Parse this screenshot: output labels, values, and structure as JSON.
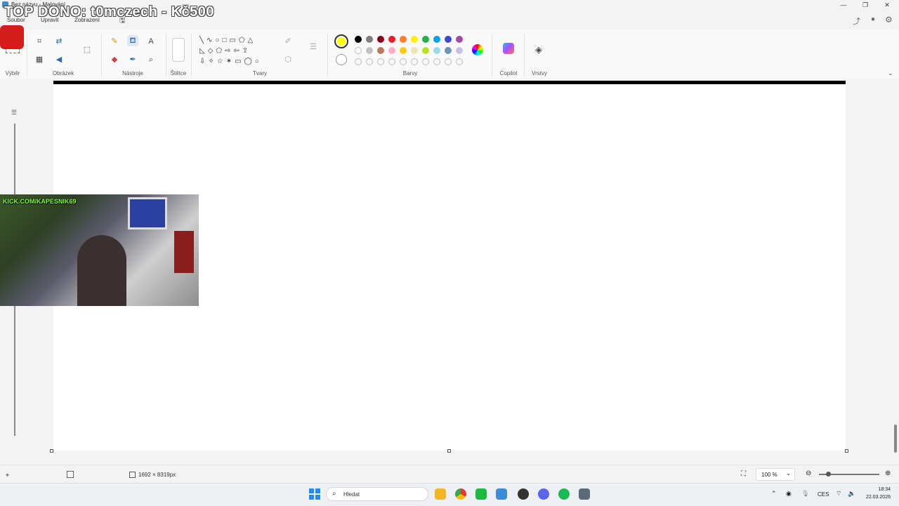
{
  "app": {
    "title": "Bez názvu - Malování"
  },
  "menu": [
    "Soubor",
    "Upravit",
    "Zobrazení"
  ],
  "ribbon": {
    "groups": [
      "Výběr",
      "Obrázek",
      "Nástroje",
      "Štětce",
      "Tvary",
      "Barvy",
      "Copilot",
      "Vrstvy"
    ]
  },
  "palette": {
    "primary": "#ffff00",
    "secondary": "#ffffff",
    "row1": [
      "#000000",
      "#7f7f7f",
      "#880015",
      "#ed1c24",
      "#ff7f27",
      "#fff200",
      "#22b14c",
      "#00a2e8",
      "#3f48cc",
      "#a349a4"
    ],
    "row2": [
      "#ffffff",
      "#c3c3c3",
      "#b97a57",
      "#ffaec9",
      "#ffc90e",
      "#efe4b0",
      "#b5e61d",
      "#99d9ea",
      "#7092be",
      "#c8bfe7"
    ],
    "row3_empty": 10
  },
  "status": {
    "canvas_size": "1692 × 8319px",
    "zoom": "100 %"
  },
  "taskbar": {
    "search_placeholder": "Hledat",
    "lang": "CES",
    "time": "18:34",
    "date": "22.03.2026"
  },
  "overlay": {
    "top_donor": "TOP DONO: t0mczech - Kč500",
    "kick": "KICK.COM/KAPESNIK69"
  }
}
